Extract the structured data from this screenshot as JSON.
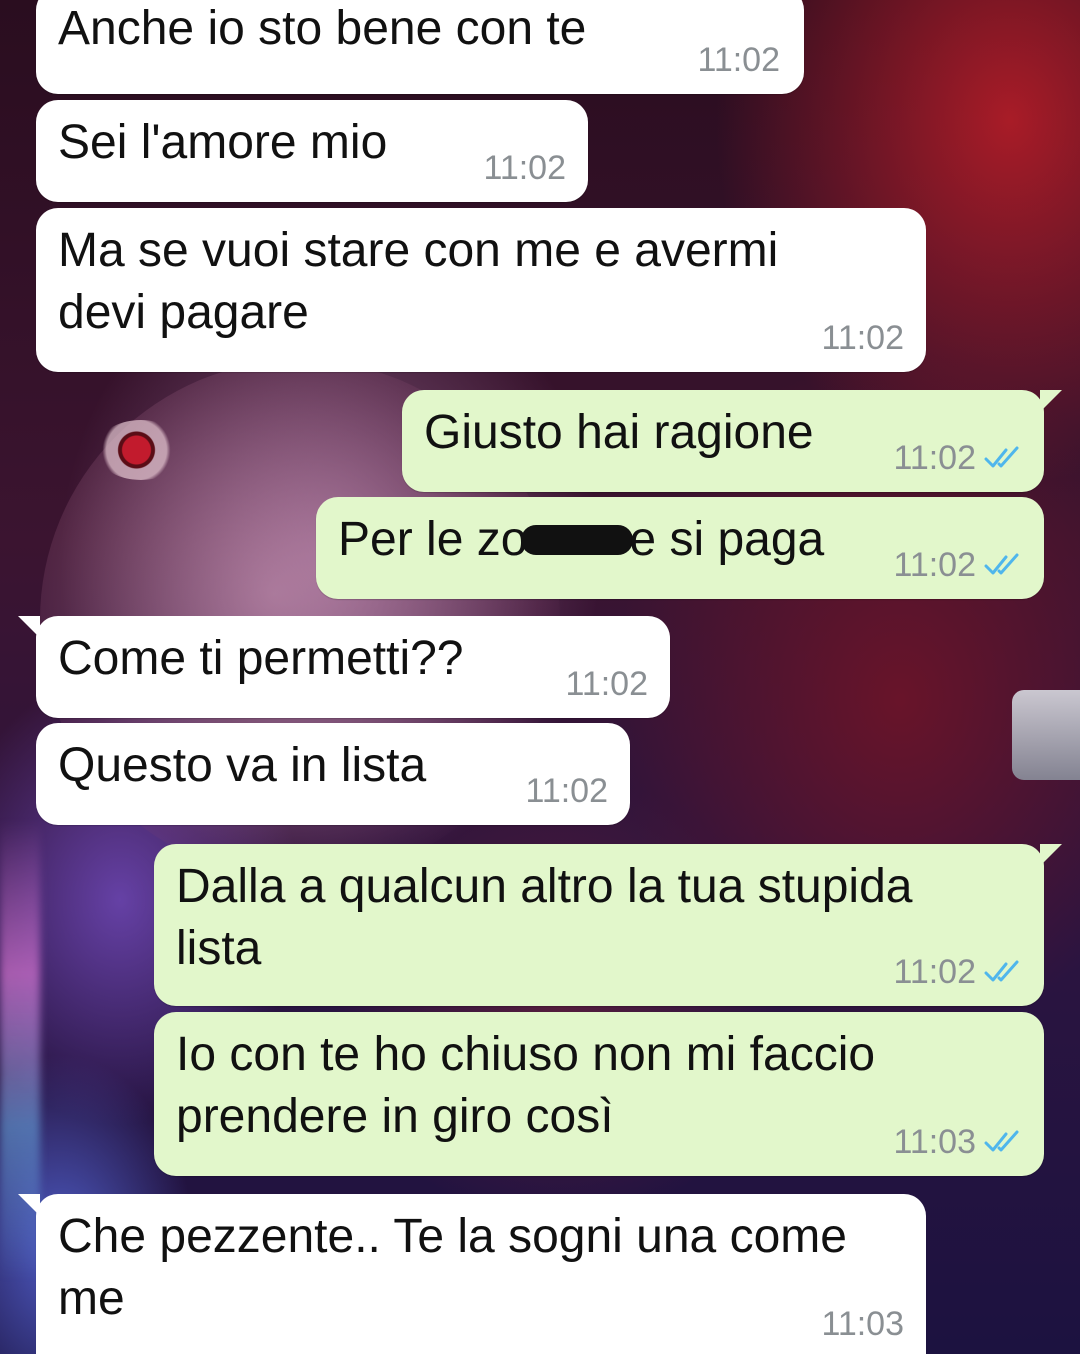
{
  "chat": {
    "messages": [
      {
        "id": "m1",
        "direction": "in",
        "text": "Anche io sto bene con te",
        "time": "11:02"
      },
      {
        "id": "m2",
        "direction": "in",
        "text": "Sei l'amore mio",
        "time": "11:02"
      },
      {
        "id": "m3",
        "direction": "in",
        "text": "Ma se vuoi stare con me e avermi\ndevi pagare",
        "time": "11:02"
      },
      {
        "id": "m4",
        "direction": "out",
        "text": "Giusto hai ragione",
        "time": "11:02",
        "status": "read"
      },
      {
        "id": "m5",
        "direction": "out",
        "text_before": "Per le zo",
        "text_redacted": "",
        "text_after": "e si paga",
        "time": "11:02",
        "status": "read"
      },
      {
        "id": "m6",
        "direction": "in",
        "text": "Come ti permetti??",
        "time": "11:02"
      },
      {
        "id": "m7",
        "direction": "in",
        "text": "Questo va in lista",
        "time": "11:02"
      },
      {
        "id": "m8",
        "direction": "out",
        "text": "Dalla a qualcun altro la tua stupida\nlista",
        "time": "11:02",
        "status": "read"
      },
      {
        "id": "m9",
        "direction": "out",
        "text": "Io con te ho chiuso non mi faccio\nprendere in giro così",
        "time": "11:03",
        "status": "read"
      },
      {
        "id": "m10",
        "direction": "in",
        "text": "Che pezzente.. Te la sogni una come\nme",
        "time": "11:03"
      }
    ]
  },
  "colors": {
    "incoming_bubble": "#ffffff",
    "outgoing_bubble": "#e2f7cb",
    "timestamp": "#8a8f93",
    "read_ticks": "#4fb6ec"
  },
  "icons": {
    "read_status": "double-check-icon"
  }
}
